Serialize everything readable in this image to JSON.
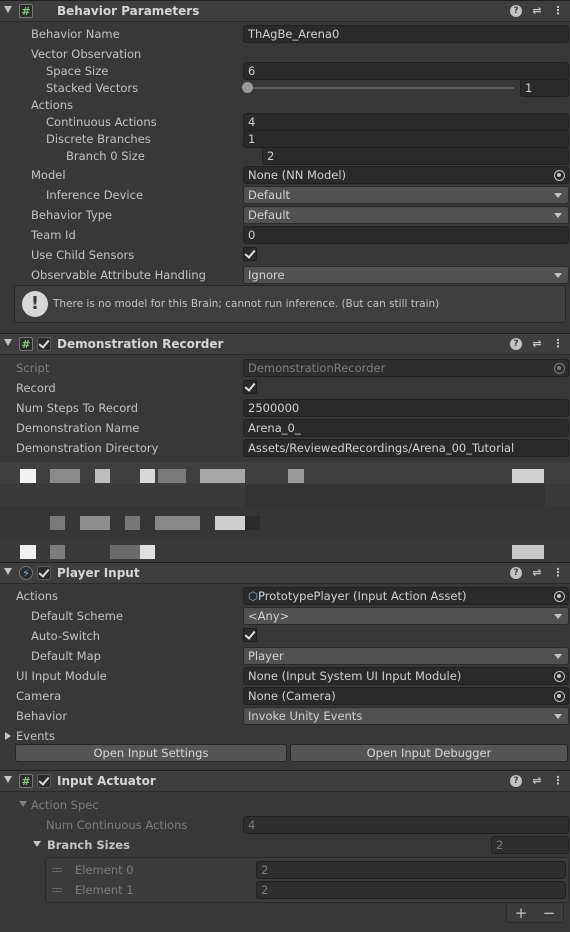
{
  "behavior_parameters": {
    "title": "Behavior Parameters",
    "behavior_name_label": "Behavior Name",
    "behavior_name_value": "ThAgBe_Arena0",
    "vector_observation_label": "Vector Observation",
    "space_size_label": "Space Size",
    "space_size_value": "6",
    "stacked_vectors_label": "Stacked Vectors",
    "stacked_vectors_value": "1",
    "actions_label": "Actions",
    "continuous_actions_label": "Continuous Actions",
    "continuous_actions_value": "4",
    "discrete_branches_label": "Discrete Branches",
    "discrete_branches_value": "1",
    "branch0_size_label": "Branch 0 Size",
    "branch0_size_value": "2",
    "model_label": "Model",
    "model_value": "None (NN Model)",
    "inference_device_label": "Inference Device",
    "inference_device_value": "Default",
    "behavior_type_label": "Behavior Type",
    "behavior_type_value": "Default",
    "team_id_label": "Team Id",
    "team_id_value": "0",
    "use_child_sensors_label": "Use Child Sensors",
    "observable_attr_label": "Observable Attribute Handling",
    "observable_attr_value": "Ignore",
    "help_message": "There is no model for this Brain; cannot run inference. (But can still train)"
  },
  "demonstration_recorder": {
    "title": "Demonstration Recorder",
    "script_label": "Script",
    "script_value": "DemonstrationRecorder",
    "record_label": "Record",
    "num_steps_label": "Num Steps To Record",
    "num_steps_value": "2500000",
    "demo_name_label": "Demonstration Name",
    "demo_name_value": "Arena_0_",
    "demo_dir_label": "Demonstration Directory",
    "demo_dir_value": "Assets/ReviewedRecordings/Arena_00_Tutorial"
  },
  "player_input": {
    "title": "Player Input",
    "actions_label": "Actions",
    "actions_value": "PrototypePlayer (Input Action Asset)",
    "default_scheme_label": "Default Scheme",
    "default_scheme_value": "<Any>",
    "auto_switch_label": "Auto-Switch",
    "default_map_label": "Default Map",
    "default_map_value": "Player",
    "ui_input_module_label": "UI Input Module",
    "ui_input_module_value": "None (Input System UI Input Module)",
    "camera_label": "Camera",
    "camera_value": "None (Camera)",
    "behavior_label": "Behavior",
    "behavior_value": "Invoke Unity Events",
    "events_label": "Events",
    "open_settings_label": "Open Input Settings",
    "open_debugger_label": "Open Input Debugger"
  },
  "input_actuator": {
    "title": "Input Actuator",
    "action_spec_label": "Action Spec",
    "num_continuous_label": "Num Continuous Actions",
    "num_continuous_value": "4",
    "branch_sizes_label": "Branch Sizes",
    "branch_sizes_count": "2",
    "elements": [
      {
        "label": "Element 0",
        "value": "2"
      },
      {
        "label": "Element 1",
        "value": "2"
      }
    ],
    "plus": "+",
    "minus": "−"
  },
  "icons": [
    "script-icon",
    "help-icon",
    "presets-icon",
    "menu-icon",
    "warning-icon",
    "object-picker-icon",
    "foldout-icon",
    "player-input-icon"
  ]
}
